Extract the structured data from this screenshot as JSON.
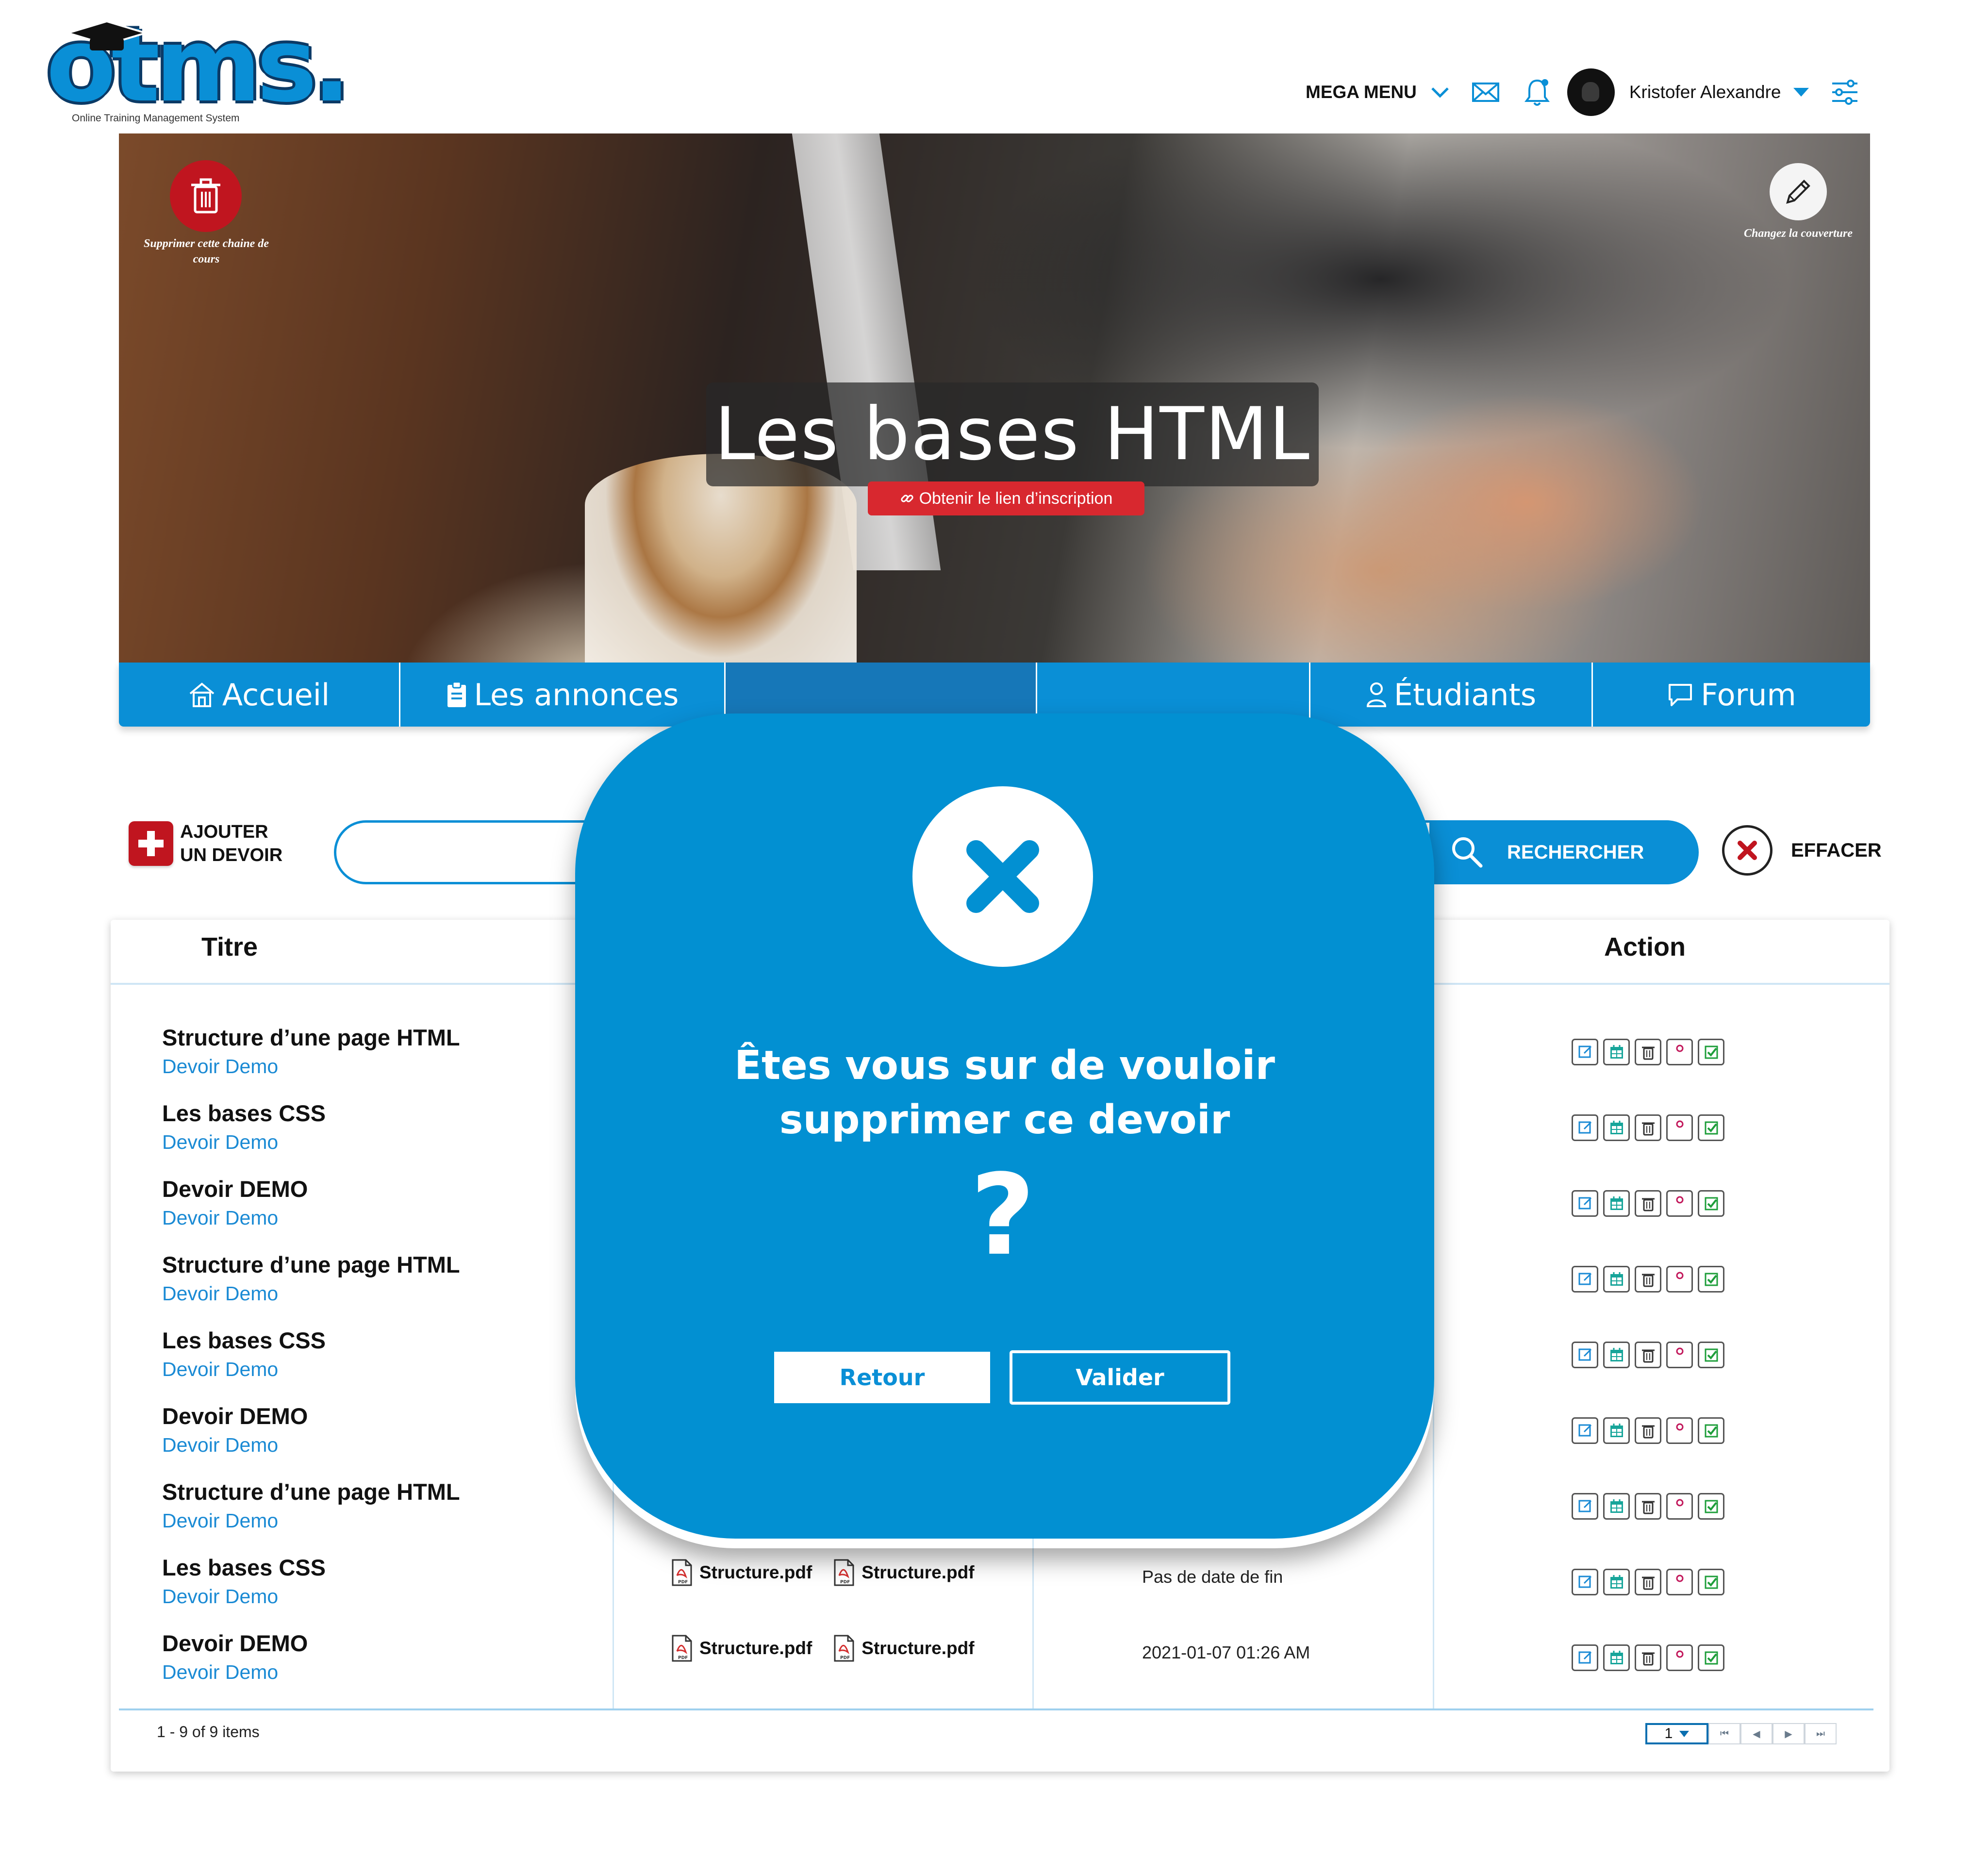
{
  "header": {
    "logo_text": "otms.",
    "logo_subtitle": "Online Training Management System",
    "mega_menu_label": "MEGA MENU",
    "user_name": "Kristofer Alexandre",
    "icons": [
      "chevron-down-icon",
      "mail-icon",
      "bell-icon",
      "avatar",
      "sliders-icon"
    ]
  },
  "hero": {
    "title": "Les bases HTML",
    "link_button": "Obtenir le lien d’inscription",
    "delete_label": "Supprimer cette chaine de cours",
    "cover_label": "Changez la couverture"
  },
  "tabs": [
    {
      "label": "Accueil",
      "icon": "home-icon"
    },
    {
      "label": "Les annonces",
      "icon": "clipboard-icon"
    },
    {
      "label": "",
      "icon": "book-icon",
      "active": true
    },
    {
      "label": "",
      "icon": "quiz-icon"
    },
    {
      "label": "Étudiants",
      "icon": "user-icon"
    },
    {
      "label": "Forum",
      "icon": "chat-icon"
    }
  ],
  "toolbar": {
    "add_label_line1": "AJOUTER",
    "add_label_line2": "UN DEVOIR",
    "search_placeholder": "",
    "search_button": "RECHERCHER",
    "clear_button": "EFFACER"
  },
  "table": {
    "headers": {
      "title": "Titre",
      "action": "Action"
    },
    "rows": [
      {
        "title": "Structure d’une page HTML",
        "subtitle": "Devoir Demo",
        "files": [],
        "date": ""
      },
      {
        "title": "Les bases CSS",
        "subtitle": "Devoir Demo",
        "files": [],
        "date": ""
      },
      {
        "title": "Devoir DEMO",
        "subtitle": "Devoir Demo",
        "files": [],
        "date": ""
      },
      {
        "title": "Structure d’une page HTML",
        "subtitle": "Devoir Demo",
        "files": [],
        "date": ""
      },
      {
        "title": "Les bases CSS",
        "subtitle": "Devoir Demo",
        "files": [],
        "date": ""
      },
      {
        "title": "Devoir DEMO",
        "subtitle": "Devoir Demo",
        "files": [],
        "date": ""
      },
      {
        "title": "Structure d’une page HTML",
        "subtitle": "Devoir Demo",
        "files": [],
        "date": ""
      },
      {
        "title": "Les bases CSS",
        "subtitle": "Devoir Demo",
        "files": [
          "Structure.pdf",
          "Structure.pdf"
        ],
        "date": "Pas de date de fin"
      },
      {
        "title": "Devoir DEMO",
        "subtitle": "Devoir Demo",
        "files": [
          "Structure.pdf",
          "Structure.pdf"
        ],
        "date": "2021-01-07 01:26 AM"
      }
    ],
    "action_icons": [
      "edit-icon",
      "calendar-icon",
      "trash-icon",
      "users-icon",
      "check-icon"
    ],
    "action_colors": [
      "#1a8ad4",
      "#17a59a",
      "#333333",
      "#c2185b",
      "#1e9e3a"
    ],
    "footer_count": "1 - 9 of 9 items",
    "pager_page": "1"
  },
  "modal": {
    "message": "Êtes vous sur de vouloir supprimer ce devoir",
    "question_mark": "?",
    "retour_label": "Retour",
    "valider_label": "Valider"
  },
  "colors": {
    "primary": "#0a8fd6",
    "modal_bg": "#0290d2",
    "danger": "#c0151f"
  }
}
